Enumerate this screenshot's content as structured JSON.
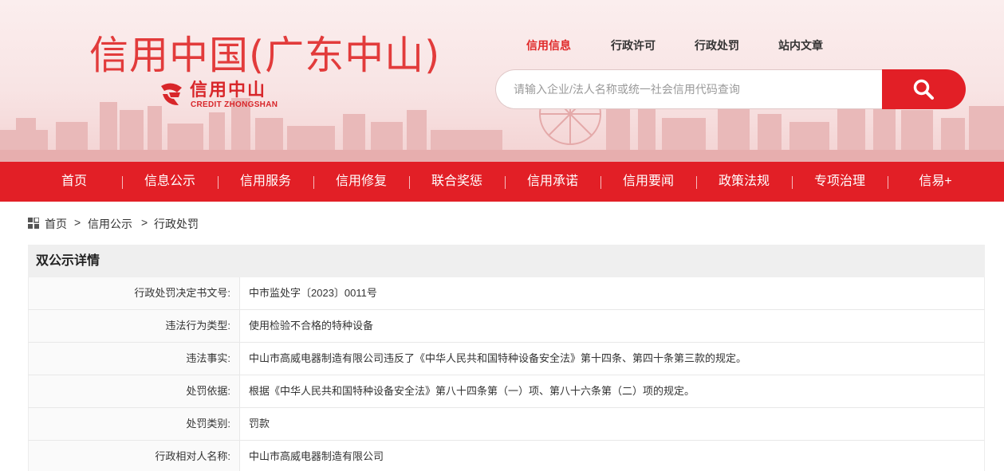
{
  "site": {
    "title": "信用中国(广东中山)",
    "logo_cn": "信用中山",
    "logo_en": "CREDIT ZHONGSHAN"
  },
  "top_links": [
    {
      "label": "信用信息",
      "active": true
    },
    {
      "label": "行政许可",
      "active": false
    },
    {
      "label": "行政处罚",
      "active": false
    },
    {
      "label": "站内文章",
      "active": false
    }
  ],
  "search": {
    "placeholder": "请输入企业/法人名称或统一社会信用代码查询",
    "icon": "search-icon"
  },
  "nav": [
    {
      "label": "首页"
    },
    {
      "label": "信息公示"
    },
    {
      "label": "信用服务"
    },
    {
      "label": "信用修复"
    },
    {
      "label": "联合奖惩"
    },
    {
      "label": "信用承诺"
    },
    {
      "label": "信用要闻"
    },
    {
      "label": "政策法规"
    },
    {
      "label": "专项治理"
    },
    {
      "label": "信易+"
    }
  ],
  "breadcrumb": {
    "icon": "grid-icon",
    "items": [
      "首页",
      "信用公示",
      "行政处罚"
    ],
    "separator": ">"
  },
  "detail": {
    "title": "双公示详情",
    "rows": [
      {
        "label": "行政处罚决定书文号:",
        "value": "中市监处字〔2023〕0011号"
      },
      {
        "label": "违法行为类型:",
        "value": "使用检验不合格的特种设备"
      },
      {
        "label": "违法事实:",
        "value": "中山市高威电器制造有限公司违反了《中华人民共和国特种设备安全法》第十四条、第四十条第三款的规定。"
      },
      {
        "label": "处罚依据:",
        "value": "根据《中华人民共和国特种设备安全法》第八十四条第（一）项、第八十六条第（二）项的规定。"
      },
      {
        "label": "处罚类别:",
        "value": "罚款"
      },
      {
        "label": "行政相对人名称:",
        "value": "中山市高威电器制造有限公司"
      }
    ]
  },
  "colors": {
    "brand_red": "#e21f26",
    "title_red": "#e23b3b",
    "banner_bg": "#f8e4e4"
  }
}
